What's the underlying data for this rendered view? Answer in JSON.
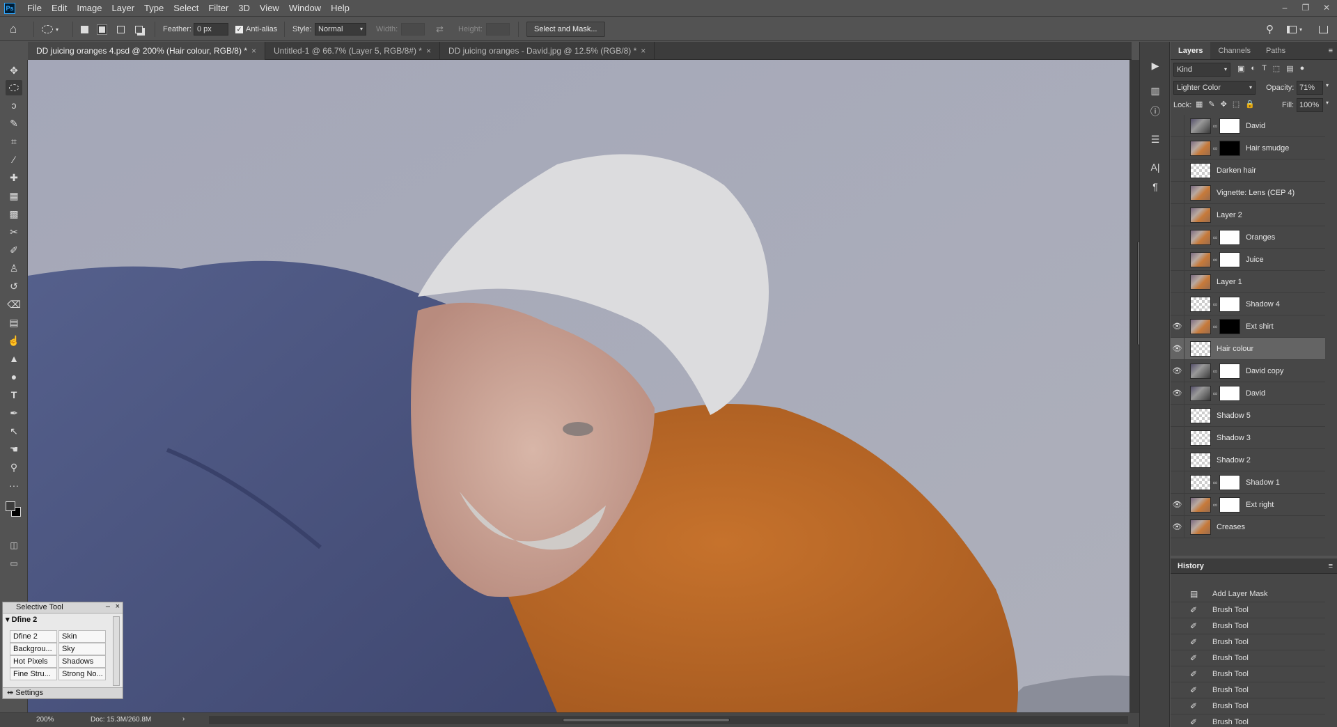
{
  "app": {
    "logo": "Ps"
  },
  "menu": [
    "File",
    "Edit",
    "Image",
    "Layer",
    "Type",
    "Select",
    "Filter",
    "3D",
    "View",
    "Window",
    "Help"
  ],
  "window_controls": [
    "–",
    "❐",
    "✕"
  ],
  "options_bar": {
    "feather_label": "Feather:",
    "feather_value": "0 px",
    "antialias_label": "Anti-alias",
    "antialias_checked": true,
    "style_label": "Style:",
    "style_value": "Normal",
    "width_label": "Width:",
    "height_label": "Height:",
    "select_mask_button": "Select and Mask..."
  },
  "tabs": [
    {
      "label": "DD juicing oranges 4.psd @ 200% (Hair colour, RGB/8) *",
      "active": true
    },
    {
      "label": "Untitled-1 @ 66.7% (Layer 5, RGB/8#) *",
      "active": false
    },
    {
      "label": "DD juicing oranges - David.jpg @ 12.5% (RGB/8) *",
      "active": false
    }
  ],
  "status": {
    "zoom": "200%",
    "doc": "Doc: 15.3M/260.8M"
  },
  "layers_panel": {
    "tabs": [
      "Layers",
      "Channels",
      "Paths"
    ],
    "filter_kind": "Kind",
    "blend_mode": "Lighter Color",
    "opacity_label": "Opacity:",
    "opacity_value": "71%",
    "lock_label": "Lock:",
    "fill_label": "Fill:",
    "fill_value": "100%",
    "layers": [
      {
        "name": "David",
        "visible": false,
        "thumb": "dark",
        "mask": "white",
        "selected": false
      },
      {
        "name": "Hair smudge",
        "visible": false,
        "thumb": "photo",
        "mask": "black",
        "selected": false
      },
      {
        "name": "Darken hair",
        "visible": false,
        "thumb": "check",
        "mask": "none",
        "selected": false
      },
      {
        "name": "Vignette: Lens (CEP 4)",
        "visible": false,
        "thumb": "photo",
        "mask": "none",
        "selected": false
      },
      {
        "name": "Layer 2",
        "visible": false,
        "thumb": "photo",
        "mask": "none",
        "selected": false
      },
      {
        "name": "Oranges",
        "visible": false,
        "thumb": "photo",
        "mask": "white",
        "selected": false
      },
      {
        "name": "Juice",
        "visible": false,
        "thumb": "photo",
        "mask": "white",
        "selected": false
      },
      {
        "name": "Layer 1",
        "visible": false,
        "thumb": "photo",
        "mask": "none",
        "selected": false
      },
      {
        "name": "Shadow 4",
        "visible": false,
        "thumb": "check",
        "mask": "white",
        "selected": false
      },
      {
        "name": "Ext shirt",
        "visible": true,
        "thumb": "photo",
        "mask": "black",
        "selected": false
      },
      {
        "name": "Hair colour",
        "visible": true,
        "thumb": "check",
        "mask": "none",
        "selected": true
      },
      {
        "name": "David copy",
        "visible": true,
        "thumb": "dark",
        "mask": "white",
        "selected": false
      },
      {
        "name": "David",
        "visible": true,
        "thumb": "dark",
        "mask": "white",
        "selected": false
      },
      {
        "name": "Shadow 5",
        "visible": false,
        "thumb": "check",
        "mask": "none",
        "selected": false
      },
      {
        "name": "Shadow 3",
        "visible": false,
        "thumb": "check",
        "mask": "none",
        "selected": false
      },
      {
        "name": "Shadow 2",
        "visible": false,
        "thumb": "check",
        "mask": "none",
        "selected": false
      },
      {
        "name": "Shadow 1",
        "visible": false,
        "thumb": "check",
        "mask": "white",
        "selected": false
      },
      {
        "name": "Ext right",
        "visible": true,
        "thumb": "photo",
        "mask": "white",
        "selected": false
      },
      {
        "name": "Creases",
        "visible": true,
        "thumb": "photo",
        "mask": "none",
        "selected": false
      }
    ]
  },
  "history_panel": {
    "title": "History",
    "items": [
      "Add Layer Mask",
      "Brush Tool",
      "Brush Tool",
      "Brush Tool",
      "Brush Tool",
      "Brush Tool",
      "Brush Tool",
      "Brush Tool",
      "Brush Tool"
    ]
  },
  "selective_tool": {
    "title": "Selective Tool",
    "section": "Dfine 2",
    "cells": [
      "Dfine 2",
      "Skin",
      "Backgrou...",
      "Sky",
      "Hot Pixels",
      "Shadows",
      "Fine Stru...",
      "Strong No..."
    ],
    "settings": "Settings"
  },
  "icons": {
    "home": "⌂",
    "move": "✥",
    "marquee": "◯",
    "lasso": "ↄ",
    "quick_select": "✎",
    "crop": "⌗",
    "eyedropper": "⁄",
    "heal": "✚",
    "patch": "▦",
    "brush": "🖌",
    "stamp": "♙",
    "history_brush": "↺",
    "eraser": "⌫",
    "gradient": "▤",
    "blur": "💧",
    "dodge": "●",
    "pen": "✒",
    "type": "T",
    "path_select": "↖",
    "hand": "✋",
    "zoom": "⚲",
    "more": "···",
    "search": "⚲",
    "play": "▶",
    "info": "ⓘ",
    "glyph": "A|",
    "para": "¶",
    "eye": "👁",
    "menu": "≡"
  }
}
